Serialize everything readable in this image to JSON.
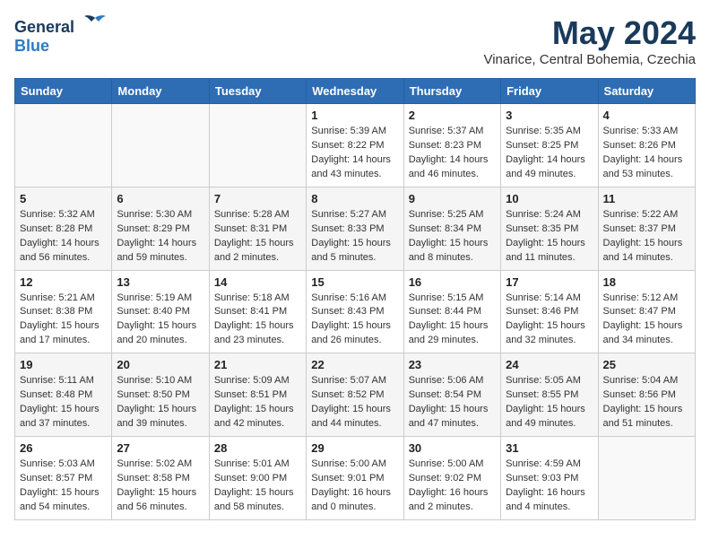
{
  "logo": {
    "general": "General",
    "blue": "Blue"
  },
  "title": "May 2024",
  "location": "Vinarice, Central Bohemia, Czechia",
  "days_header": [
    "Sunday",
    "Monday",
    "Tuesday",
    "Wednesday",
    "Thursday",
    "Friday",
    "Saturday"
  ],
  "weeks": [
    [
      {
        "day": "",
        "info": ""
      },
      {
        "day": "",
        "info": ""
      },
      {
        "day": "",
        "info": ""
      },
      {
        "day": "1",
        "info": "Sunrise: 5:39 AM\nSunset: 8:22 PM\nDaylight: 14 hours\nand 43 minutes."
      },
      {
        "day": "2",
        "info": "Sunrise: 5:37 AM\nSunset: 8:23 PM\nDaylight: 14 hours\nand 46 minutes."
      },
      {
        "day": "3",
        "info": "Sunrise: 5:35 AM\nSunset: 8:25 PM\nDaylight: 14 hours\nand 49 minutes."
      },
      {
        "day": "4",
        "info": "Sunrise: 5:33 AM\nSunset: 8:26 PM\nDaylight: 14 hours\nand 53 minutes."
      }
    ],
    [
      {
        "day": "5",
        "info": "Sunrise: 5:32 AM\nSunset: 8:28 PM\nDaylight: 14 hours\nand 56 minutes."
      },
      {
        "day": "6",
        "info": "Sunrise: 5:30 AM\nSunset: 8:29 PM\nDaylight: 14 hours\nand 59 minutes."
      },
      {
        "day": "7",
        "info": "Sunrise: 5:28 AM\nSunset: 8:31 PM\nDaylight: 15 hours\nand 2 minutes."
      },
      {
        "day": "8",
        "info": "Sunrise: 5:27 AM\nSunset: 8:33 PM\nDaylight: 15 hours\nand 5 minutes."
      },
      {
        "day": "9",
        "info": "Sunrise: 5:25 AM\nSunset: 8:34 PM\nDaylight: 15 hours\nand 8 minutes."
      },
      {
        "day": "10",
        "info": "Sunrise: 5:24 AM\nSunset: 8:35 PM\nDaylight: 15 hours\nand 11 minutes."
      },
      {
        "day": "11",
        "info": "Sunrise: 5:22 AM\nSunset: 8:37 PM\nDaylight: 15 hours\nand 14 minutes."
      }
    ],
    [
      {
        "day": "12",
        "info": "Sunrise: 5:21 AM\nSunset: 8:38 PM\nDaylight: 15 hours\nand 17 minutes."
      },
      {
        "day": "13",
        "info": "Sunrise: 5:19 AM\nSunset: 8:40 PM\nDaylight: 15 hours\nand 20 minutes."
      },
      {
        "day": "14",
        "info": "Sunrise: 5:18 AM\nSunset: 8:41 PM\nDaylight: 15 hours\nand 23 minutes."
      },
      {
        "day": "15",
        "info": "Sunrise: 5:16 AM\nSunset: 8:43 PM\nDaylight: 15 hours\nand 26 minutes."
      },
      {
        "day": "16",
        "info": "Sunrise: 5:15 AM\nSunset: 8:44 PM\nDaylight: 15 hours\nand 29 minutes."
      },
      {
        "day": "17",
        "info": "Sunrise: 5:14 AM\nSunset: 8:46 PM\nDaylight: 15 hours\nand 32 minutes."
      },
      {
        "day": "18",
        "info": "Sunrise: 5:12 AM\nSunset: 8:47 PM\nDaylight: 15 hours\nand 34 minutes."
      }
    ],
    [
      {
        "day": "19",
        "info": "Sunrise: 5:11 AM\nSunset: 8:48 PM\nDaylight: 15 hours\nand 37 minutes."
      },
      {
        "day": "20",
        "info": "Sunrise: 5:10 AM\nSunset: 8:50 PM\nDaylight: 15 hours\nand 39 minutes."
      },
      {
        "day": "21",
        "info": "Sunrise: 5:09 AM\nSunset: 8:51 PM\nDaylight: 15 hours\nand 42 minutes."
      },
      {
        "day": "22",
        "info": "Sunrise: 5:07 AM\nSunset: 8:52 PM\nDaylight: 15 hours\nand 44 minutes."
      },
      {
        "day": "23",
        "info": "Sunrise: 5:06 AM\nSunset: 8:54 PM\nDaylight: 15 hours\nand 47 minutes."
      },
      {
        "day": "24",
        "info": "Sunrise: 5:05 AM\nSunset: 8:55 PM\nDaylight: 15 hours\nand 49 minutes."
      },
      {
        "day": "25",
        "info": "Sunrise: 5:04 AM\nSunset: 8:56 PM\nDaylight: 15 hours\nand 51 minutes."
      }
    ],
    [
      {
        "day": "26",
        "info": "Sunrise: 5:03 AM\nSunset: 8:57 PM\nDaylight: 15 hours\nand 54 minutes."
      },
      {
        "day": "27",
        "info": "Sunrise: 5:02 AM\nSunset: 8:58 PM\nDaylight: 15 hours\nand 56 minutes."
      },
      {
        "day": "28",
        "info": "Sunrise: 5:01 AM\nSunset: 9:00 PM\nDaylight: 15 hours\nand 58 minutes."
      },
      {
        "day": "29",
        "info": "Sunrise: 5:00 AM\nSunset: 9:01 PM\nDaylight: 16 hours\nand 0 minutes."
      },
      {
        "day": "30",
        "info": "Sunrise: 5:00 AM\nSunset: 9:02 PM\nDaylight: 16 hours\nand 2 minutes."
      },
      {
        "day": "31",
        "info": "Sunrise: 4:59 AM\nSunset: 9:03 PM\nDaylight: 16 hours\nand 4 minutes."
      },
      {
        "day": "",
        "info": ""
      }
    ]
  ]
}
